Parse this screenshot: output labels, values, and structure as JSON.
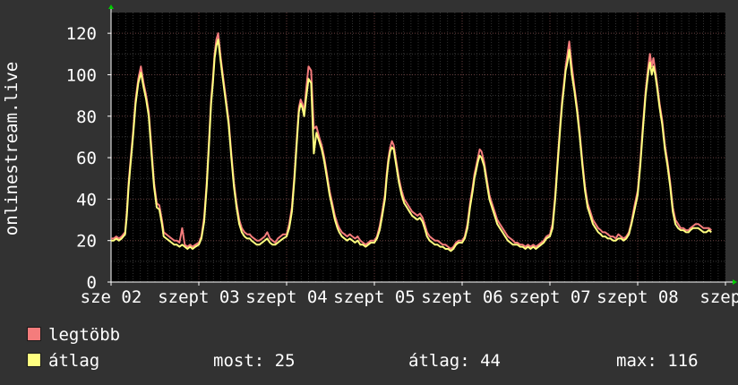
{
  "chart_data": {
    "type": "line",
    "ylabel": "onlinestream.live",
    "ylim": [
      0,
      130
    ],
    "yticks": [
      0,
      20,
      40,
      60,
      80,
      100,
      120
    ],
    "xtick_labels": [
      "sze 02",
      "szept 03",
      "szept 04",
      "szept 05",
      "szept 06",
      "szept 07",
      "szept 08",
      "szept"
    ],
    "grid": true,
    "legend_position": "bottom-left",
    "x": [
      0,
      0.03,
      0.06,
      0.09,
      0.12,
      0.14,
      0.16,
      0.18,
      0.2,
      0.22,
      0.25,
      0.28,
      0.31,
      0.34,
      0.37,
      0.4,
      0.43,
      0.46,
      0.49,
      0.52,
      0.55,
      0.58,
      0.6,
      0.63,
      0.66,
      0.69,
      0.72,
      0.75,
      0.78,
      0.81,
      0.84,
      0.87,
      0.9,
      0.93,
      0.96,
      1,
      1.03,
      1.06,
      1.09,
      1.12,
      1.14,
      1.16,
      1.18,
      1.2,
      1.22,
      1.25,
      1.28,
      1.31,
      1.34,
      1.37,
      1.4,
      1.43,
      1.46,
      1.49,
      1.52,
      1.55,
      1.58,
      1.6,
      1.63,
      1.66,
      1.69,
      1.72,
      1.75,
      1.78,
      1.81,
      1.84,
      1.87,
      1.9,
      1.93,
      1.96,
      2,
      2.03,
      2.06,
      2.09,
      2.12,
      2.14,
      2.16,
      2.18,
      2.2,
      2.22,
      2.25,
      2.28,
      2.31,
      2.34,
      2.37,
      2.4,
      2.43,
      2.46,
      2.49,
      2.52,
      2.55,
      2.58,
      2.6,
      2.63,
      2.66,
      2.69,
      2.72,
      2.75,
      2.78,
      2.81,
      2.84,
      2.87,
      2.9,
      2.93,
      2.96,
      3,
      3.03,
      3.06,
      3.09,
      3.12,
      3.14,
      3.16,
      3.18,
      3.2,
      3.22,
      3.25,
      3.28,
      3.31,
      3.34,
      3.37,
      3.4,
      3.43,
      3.46,
      3.49,
      3.52,
      3.55,
      3.58,
      3.6,
      3.63,
      3.66,
      3.69,
      3.72,
      3.75,
      3.78,
      3.81,
      3.84,
      3.87,
      3.9,
      3.93,
      3.96,
      4,
      4.03,
      4.06,
      4.09,
      4.12,
      4.14,
      4.16,
      4.18,
      4.2,
      4.22,
      4.25,
      4.28,
      4.31,
      4.34,
      4.37,
      4.4,
      4.43,
      4.46,
      4.49,
      4.52,
      4.55,
      4.58,
      4.6,
      4.63,
      4.66,
      4.69,
      4.72,
      4.75,
      4.78,
      4.81,
      4.84,
      4.87,
      4.9,
      4.93,
      4.96,
      5,
      5.03,
      5.06,
      5.09,
      5.12,
      5.14,
      5.16,
      5.18,
      5.2,
      5.22,
      5.25,
      5.28,
      5.31,
      5.34,
      5.37,
      5.4,
      5.43,
      5.46,
      5.49,
      5.52,
      5.55,
      5.58,
      5.6,
      5.63,
      5.66,
      5.69,
      5.72,
      5.75,
      5.78,
      5.81,
      5.84,
      5.87,
      5.9,
      5.93,
      5.96,
      6,
      6.03,
      6.06,
      6.09,
      6.12,
      6.14,
      6.16,
      6.18,
      6.2,
      6.22,
      6.25,
      6.28,
      6.31,
      6.34,
      6.37,
      6.4,
      6.43,
      6.46,
      6.49,
      6.52,
      6.55,
      6.58,
      6.6,
      6.63,
      6.66,
      6.69,
      6.72,
      6.75,
      6.78,
      6.81,
      6.84,
      6.87,
      6.9,
      6.93,
      6.96,
      7
    ],
    "series": [
      {
        "name": "legtöbb",
        "color": "#f47c7c",
        "values": [
          21,
          21,
          22,
          21,
          22,
          23,
          24,
          34,
          48,
          58,
          72,
          88,
          98,
          104,
          96,
          90,
          82,
          65,
          48,
          38,
          37,
          30,
          24,
          23,
          22,
          21,
          20,
          20,
          19,
          26,
          18,
          17,
          18,
          17,
          18,
          19,
          22,
          31,
          48,
          72,
          88,
          98,
          110,
          117,
          120,
          108,
          98,
          88,
          78,
          62,
          48,
          38,
          30,
          26,
          24,
          23,
          23,
          22,
          21,
          20,
          20,
          21,
          22,
          24,
          21,
          20,
          19,
          21,
          22,
          23,
          23,
          28,
          36,
          52,
          72,
          84,
          88,
          86,
          82,
          92,
          104,
          102,
          74,
          75,
          70,
          66,
          60,
          52,
          44,
          38,
          32,
          28,
          26,
          24,
          23,
          22,
          23,
          22,
          21,
          22,
          20,
          19,
          18,
          19,
          20,
          20,
          22,
          27,
          34,
          42,
          52,
          60,
          65,
          68,
          66,
          58,
          50,
          44,
          40,
          38,
          36,
          34,
          33,
          32,
          33,
          31,
          27,
          24,
          22,
          21,
          20,
          20,
          19,
          18,
          18,
          17,
          16,
          17,
          19,
          20,
          20,
          22,
          28,
          38,
          46,
          52,
          56,
          60,
          64,
          63,
          58,
          50,
          42,
          38,
          34,
          30,
          28,
          26,
          24,
          22,
          21,
          20,
          19,
          19,
          18,
          18,
          17,
          18,
          17,
          18,
          17,
          18,
          19,
          20,
          22,
          23,
          28,
          42,
          60,
          78,
          88,
          96,
          104,
          110,
          116,
          104,
          94,
          84,
          72,
          58,
          46,
          38,
          34,
          30,
          28,
          26,
          25,
          24,
          24,
          23,
          22,
          22,
          21,
          23,
          22,
          21,
          22,
          24,
          29,
          36,
          44,
          58,
          76,
          92,
          104,
          110,
          104,
          108,
          102,
          96,
          86,
          78,
          66,
          58,
          48,
          36,
          30,
          28,
          26,
          26,
          25,
          25,
          26,
          27,
          28,
          28,
          27,
          26,
          26,
          26,
          25
        ]
      },
      {
        "name": "átlag",
        "color": "#ffff80",
        "values": [
          20,
          20,
          21,
          20,
          21,
          22,
          23,
          32,
          46,
          56,
          70,
          86,
          96,
          101,
          94,
          88,
          80,
          62,
          46,
          36,
          35,
          28,
          22,
          21,
          20,
          19,
          18,
          18,
          17,
          18,
          17,
          16,
          17,
          16,
          17,
          18,
          21,
          29,
          46,
          70,
          86,
          96,
          108,
          114,
          117,
          106,
          96,
          86,
          76,
          60,
          46,
          36,
          28,
          24,
          22,
          21,
          21,
          20,
          19,
          18,
          18,
          19,
          20,
          21,
          19,
          18,
          18,
          19,
          20,
          21,
          22,
          26,
          34,
          50,
          70,
          82,
          86,
          84,
          80,
          88,
          98,
          96,
          62,
          72,
          68,
          64,
          58,
          50,
          42,
          36,
          30,
          26,
          24,
          22,
          21,
          20,
          21,
          20,
          19,
          20,
          18,
          18,
          17,
          18,
          19,
          19,
          21,
          25,
          32,
          40,
          50,
          58,
          63,
          65,
          64,
          56,
          48,
          42,
          38,
          36,
          34,
          32,
          31,
          30,
          31,
          29,
          25,
          22,
          20,
          19,
          18,
          18,
          17,
          17,
          16,
          16,
          15,
          16,
          18,
          19,
          19,
          21,
          26,
          36,
          44,
          50,
          54,
          58,
          61,
          60,
          56,
          48,
          40,
          36,
          32,
          28,
          26,
          24,
          22,
          20,
          19,
          18,
          18,
          18,
          17,
          17,
          16,
          17,
          16,
          17,
          16,
          17,
          18,
          19,
          21,
          22,
          26,
          40,
          58,
          76,
          86,
          94,
          102,
          106,
          112,
          100,
          92,
          82,
          70,
          56,
          44,
          36,
          32,
          28,
          26,
          24,
          23,
          22,
          22,
          21,
          21,
          20,
          20,
          21,
          21,
          20,
          21,
          23,
          28,
          34,
          42,
          56,
          74,
          90,
          101,
          106,
          100,
          104,
          100,
          94,
          84,
          76,
          64,
          56,
          46,
          34,
          28,
          26,
          25,
          25,
          24,
          24,
          25,
          26,
          26,
          26,
          25,
          24,
          24,
          25,
          24
        ]
      }
    ]
  },
  "legend": {
    "max_label": "legtöbb",
    "avg_label": "átlag",
    "max_color": "#f47c7c",
    "avg_color": "#ffff80"
  },
  "stats": {
    "now": "most: 25",
    "avg": "átlag: 44",
    "max": "max: 116"
  }
}
